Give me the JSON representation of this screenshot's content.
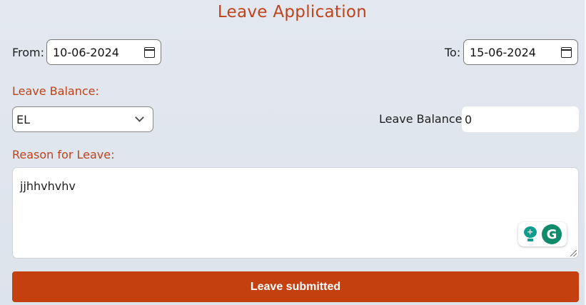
{
  "header": {
    "title": "Leave Application"
  },
  "dates": {
    "from_label": "From:",
    "from_value": "10-06-2024",
    "to_label": "To:",
    "to_value": "15-06-2024"
  },
  "leave_balance_section": {
    "heading": "Leave Balance:",
    "leave_type_selected": "EL",
    "balance_label": "Leave Balance:",
    "balance_value": "0"
  },
  "reason": {
    "heading": "Reason for Leave:",
    "text": "jjhhvhvhv"
  },
  "extension": {
    "grammarly_letter": "G"
  },
  "actions": {
    "submit_label": "Leave submitted"
  },
  "colors": {
    "accent": "#c4400f",
    "title": "#c0421a",
    "background": "#e1e6ee"
  }
}
